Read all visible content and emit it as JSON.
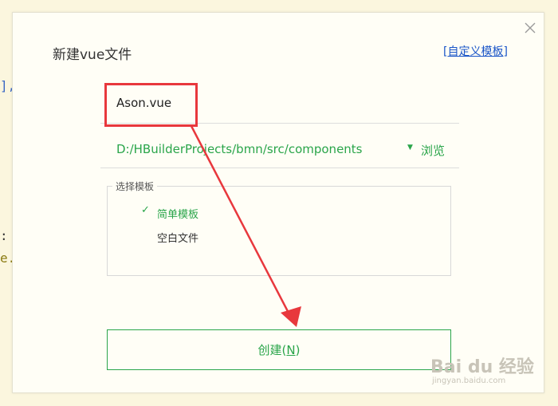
{
  "background": {
    "code_fragments": [
      "],",
      ":",
      "e."
    ]
  },
  "dialog": {
    "title": "新建vue文件",
    "custom_template_link": "自定义模板",
    "custom_template_link_open": "[",
    "custom_template_link_close": "]",
    "close_icon": "close-icon",
    "file_name": {
      "value": "Ason.vue"
    },
    "path": {
      "value": "D:/HBuilderProjects/bmn/src/components",
      "dropdown_icon": "caret-down-icon",
      "browse_label": "浏览"
    },
    "template_group": {
      "legend": "选择模板",
      "options": [
        {
          "label": "简单模板",
          "selected": true
        },
        {
          "label": "空白文件",
          "selected": false
        }
      ],
      "check_icon": "check-icon"
    },
    "create_button": {
      "label_prefix": "创建(",
      "hotkey": "N",
      "label_suffix": ")"
    }
  },
  "annotation": {
    "highlight_color": "#e8383d",
    "arrow_color": "#e8383d"
  },
  "watermark": {
    "logo": "Bai du 经验",
    "subtext": "jingyan.baidu.com"
  },
  "colors": {
    "accent_green": "#2aa54a",
    "link_blue": "#1a55c8",
    "background": "#fbf6de"
  }
}
